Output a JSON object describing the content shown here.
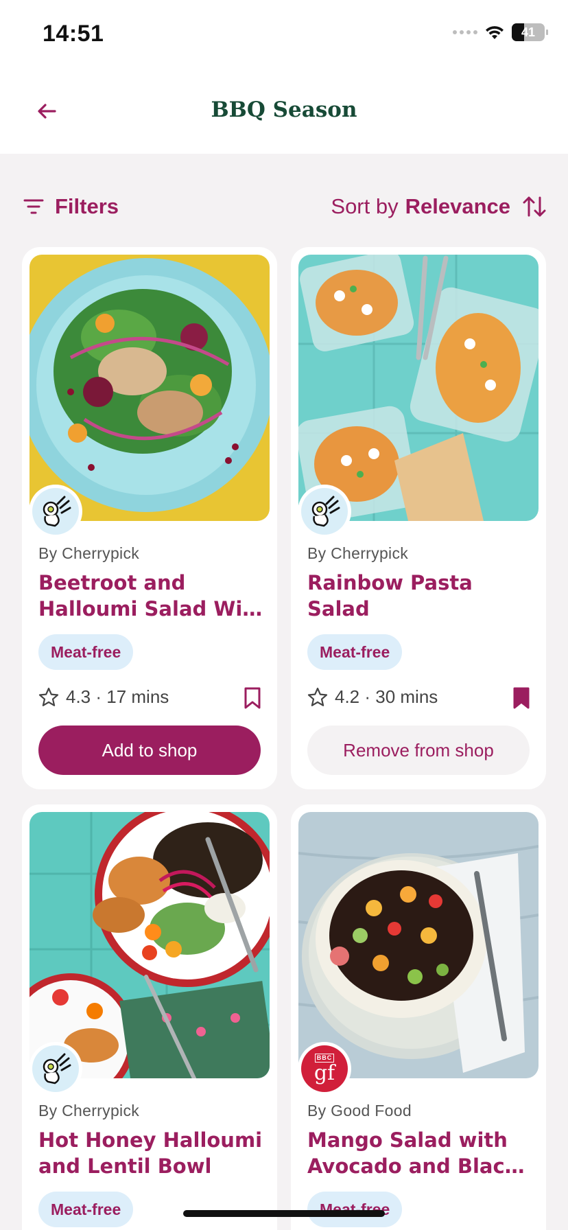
{
  "status_bar": {
    "time": "14:51",
    "battery": "41"
  },
  "nav": {
    "title": "BBQ Season",
    "back_icon": "arrow-left-icon"
  },
  "toolbar": {
    "filters_label": "Filters",
    "sort_prefix": "Sort by",
    "sort_value": "Relevance"
  },
  "colors": {
    "brand": "#9b1e5f",
    "title_green": "#174a36",
    "tag_bg": "#ddeefa",
    "background": "#f4f2f3"
  },
  "recipes": [
    {
      "source": "By Cherrypick",
      "title": "Beetroot and Halloumi Salad Wi…",
      "tag": "Meat-free",
      "rating": "4.3",
      "time": "17 mins",
      "meta": "4.3 · 17 mins",
      "saved": false,
      "button": "Add to shop",
      "badge": "cherrypick-logo"
    },
    {
      "source": "By Cherrypick",
      "title": "Rainbow Pasta Salad",
      "tag": "Meat-free",
      "rating": "4.2",
      "time": "30 mins",
      "meta": "4.2 · 30 mins",
      "saved": true,
      "button": "Remove from shop",
      "badge": "cherrypick-logo"
    },
    {
      "source": "By Cherrypick",
      "title": "Hot Honey Halloumi and Lentil Bowl",
      "tag": "Meat-free",
      "badge": "cherrypick-logo"
    },
    {
      "source": "By Good Food",
      "title": "Mango Salad with Avocado and Blac…",
      "tag": "Meat-free",
      "badge": "bbc-good-food-logo",
      "badge_text": "gf",
      "badge_small_text": "BBC"
    }
  ]
}
